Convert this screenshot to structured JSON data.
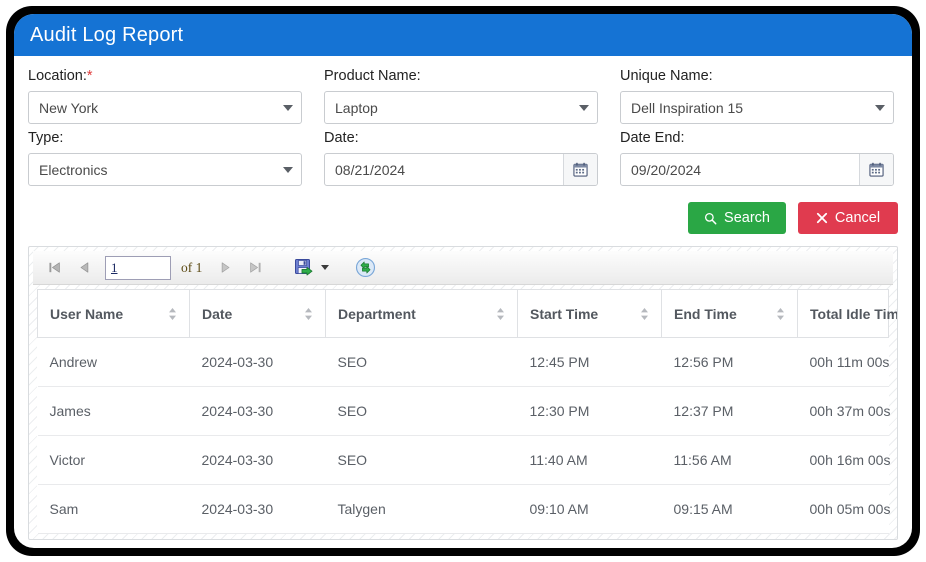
{
  "window": {
    "title": "Audit Log Report"
  },
  "form": {
    "location": {
      "label": "Location:",
      "required_mark": "*",
      "value": "New York"
    },
    "product_name": {
      "label": "Product Name:",
      "value": "Laptop"
    },
    "unique_name": {
      "label": "Unique Name:",
      "value": "Dell Inspiration 15"
    },
    "type": {
      "label": "Type:",
      "value": "Electronics"
    },
    "date": {
      "label": "Date:",
      "value": "08/21/2024"
    },
    "date_end": {
      "label": "Date End:",
      "value": "09/20/2024"
    }
  },
  "actions": {
    "search_label": "Search",
    "search_icon": "search-icon",
    "search_color": "#2aa745",
    "cancel_label": "Cancel",
    "cancel_icon": "close-icon",
    "cancel_color": "#e03b4f"
  },
  "pager": {
    "first_icon": "first-page-icon",
    "prev_icon": "previous-page-icon",
    "page_value": "1",
    "of_text": "of 1",
    "next_icon": "next-page-icon",
    "last_icon": "last-page-icon",
    "export_icon": "export-save-icon",
    "refresh_icon": "refresh-icon"
  },
  "table": {
    "columns": [
      {
        "label": "User Name",
        "sortable": true
      },
      {
        "label": "Date",
        "sortable": true
      },
      {
        "label": "Department",
        "sortable": true
      },
      {
        "label": "Start Time",
        "sortable": true
      },
      {
        "label": "End Time",
        "sortable": true
      },
      {
        "label": "Total Idle Time",
        "sortable": false
      }
    ],
    "rows": [
      {
        "user": "Andrew",
        "date": "2024-03-30",
        "department": "SEO",
        "start": "12:45 PM",
        "end": "12:56 PM",
        "idle": "00h 11m 00s"
      },
      {
        "user": "James",
        "date": "2024-03-30",
        "department": "SEO",
        "start": "12:30 PM",
        "end": "12:37 PM",
        "idle": "00h 37m 00s"
      },
      {
        "user": "Victor",
        "date": "2024-03-30",
        "department": "SEO",
        "start": "11:40 AM",
        "end": "11:56 AM",
        "idle": "00h 16m 00s"
      },
      {
        "user": "Sam",
        "date": "2024-03-30",
        "department": "Talygen",
        "start": "09:10 AM",
        "end": "09:15 AM",
        "idle": "00h 05m 00s"
      }
    ]
  },
  "theme": {
    "header_blue": "#1573d4",
    "required_red": "#e03b3b"
  }
}
